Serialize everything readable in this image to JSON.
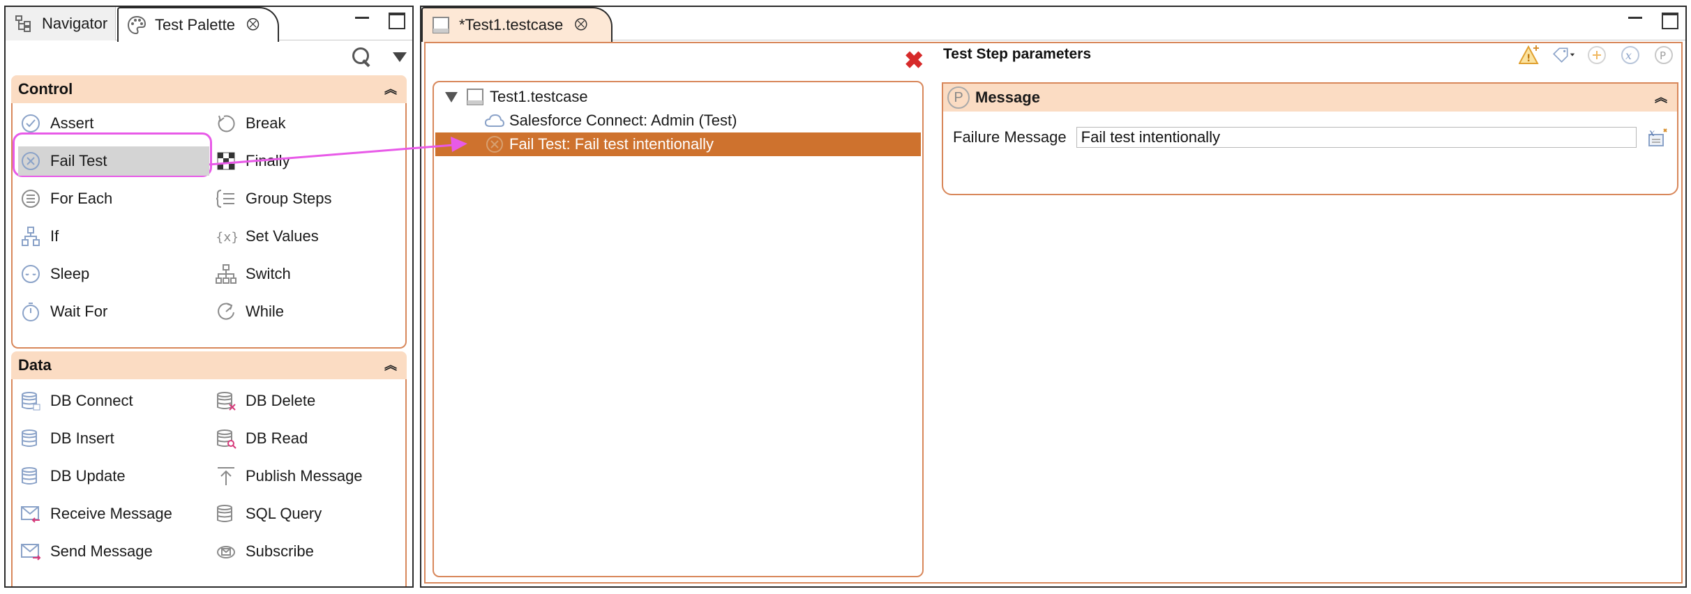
{
  "left_panel": {
    "tabs": [
      {
        "label": "Navigator",
        "icon": "navigator-icon"
      },
      {
        "label": "Test Palette",
        "icon": "palette-icon"
      }
    ],
    "sections": [
      {
        "title": "Control",
        "items": [
          {
            "label": "Assert",
            "icon": "assert-icon"
          },
          {
            "label": "Break",
            "icon": "break-icon"
          },
          {
            "label": "Fail Test",
            "icon": "fail-test-icon",
            "selected": true
          },
          {
            "label": "Finally",
            "icon": "finally-icon"
          },
          {
            "label": "For Each",
            "icon": "for-each-icon"
          },
          {
            "label": "Group Steps",
            "icon": "group-steps-icon"
          },
          {
            "label": "If",
            "icon": "if-icon"
          },
          {
            "label": "Set Values",
            "icon": "set-values-icon"
          },
          {
            "label": "Sleep",
            "icon": "sleep-icon"
          },
          {
            "label": "Switch",
            "icon": "switch-icon"
          },
          {
            "label": "Wait For",
            "icon": "wait-for-icon"
          },
          {
            "label": "While",
            "icon": "while-icon"
          }
        ]
      },
      {
        "title": "Data",
        "items": [
          {
            "label": "DB Connect",
            "icon": "db-connect-icon"
          },
          {
            "label": "DB Delete",
            "icon": "db-delete-icon"
          },
          {
            "label": "DB Insert",
            "icon": "db-insert-icon"
          },
          {
            "label": "DB Read",
            "icon": "db-read-icon"
          },
          {
            "label": "DB Update",
            "icon": "db-update-icon"
          },
          {
            "label": "Publish Message",
            "icon": "publish-message-icon"
          },
          {
            "label": "Receive Message",
            "icon": "receive-message-icon"
          },
          {
            "label": "SQL Query",
            "icon": "sql-query-icon"
          },
          {
            "label": "Send Message",
            "icon": "send-message-icon"
          },
          {
            "label": "Subscribe",
            "icon": "subscribe-icon"
          }
        ]
      }
    ]
  },
  "editor": {
    "tab_label": "*Test1.testcase",
    "tree": {
      "root": "Test1.testcase",
      "children": [
        {
          "label": "Salesforce Connect: Admin (Test)",
          "icon": "cloud-icon"
        },
        {
          "label": "Fail Test: Fail test intentionally",
          "icon": "fail-test-icon",
          "selected": true
        }
      ]
    },
    "params_title": "Test Step parameters",
    "message_section": {
      "title": "Message",
      "field_label": "Failure Message",
      "field_value": "Fail test intentionally"
    }
  },
  "colors": {
    "section_header": "#fbdcc3",
    "section_border": "#d8875a",
    "selected_row": "#ce722e",
    "highlight_annotation": "#e85ae8",
    "delete_icon": "#d62a2a"
  }
}
